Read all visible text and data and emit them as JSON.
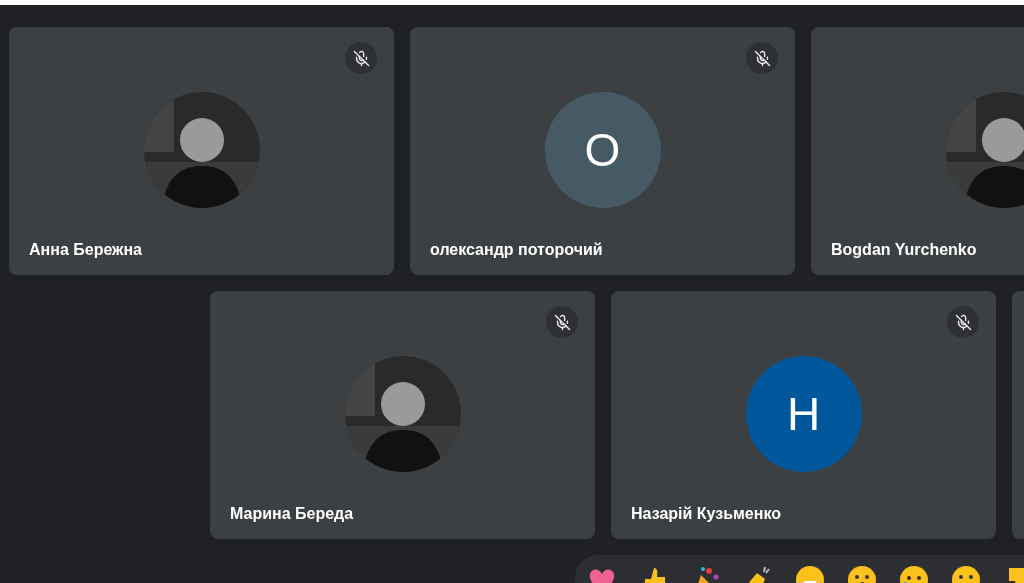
{
  "tile_rows": [
    {
      "tiles": [
        {
          "kind": "participant",
          "name": "Анна Бережна",
          "muted": true
        },
        {
          "kind": "participant",
          "name": "олександр поторочий",
          "muted": true,
          "avatar": {
            "kind": "letter",
            "letter": "О",
            "color": "#455a64"
          }
        },
        {
          "kind": "participant",
          "name": "Bogdan Yurchenko"
        }
      ]
    },
    {
      "tiles": [
        {
          "kind": "participant",
          "name": "Марина Береда",
          "muted": true
        },
        {
          "kind": "participant",
          "name": "Назарій Кузьменко",
          "muted": true,
          "avatar": {
            "kind": "letter",
            "letter": "Н",
            "color": "#01579b"
          }
        },
        {
          "kind": "blank"
        }
      ]
    }
  ],
  "reactions": [
    {
      "kind": "heart"
    },
    {
      "kind": "thumbs-up"
    },
    {
      "kind": "party"
    },
    {
      "kind": "clap"
    },
    {
      "kind": "laugh"
    },
    {
      "kind": "surprised"
    },
    {
      "kind": "sad"
    },
    {
      "kind": "thinking"
    },
    {
      "kind": "thumbs-down"
    }
  ]
}
